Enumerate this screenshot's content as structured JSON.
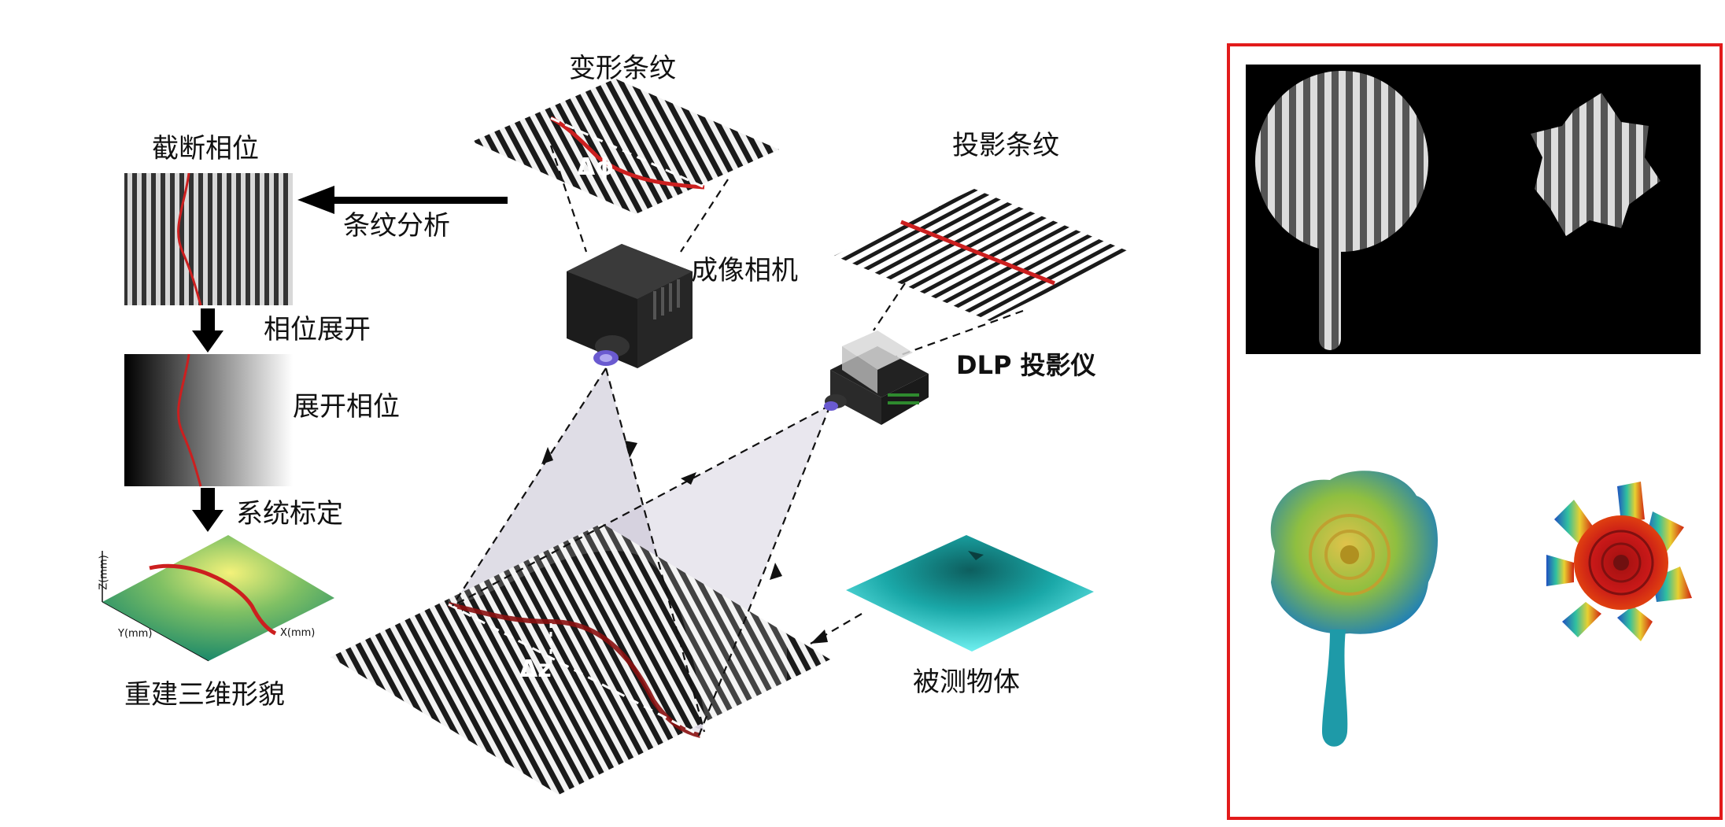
{
  "labels": {
    "deformed_fringe": "变形条纹",
    "projected_fringe": "投影条纹",
    "wrapped_phase": "截断相位",
    "fringe_analysis": "条纹分析",
    "camera": "成像相机",
    "phase_unwrapping": "相位展开",
    "dlp_projector": "DLP 投影仪",
    "unwrapped_phase": "展开相位",
    "system_calibration": "系统标定",
    "reconstruct_3d": "重建三维形貌",
    "measured_object": "被测物体",
    "delta_phi": "Δϕ",
    "delta_z": "Δz"
  },
  "axes": {
    "z": "Z(mm)",
    "y": "Y(mm)",
    "x": "X(mm)"
  },
  "colors": {
    "highlight_red": "#cc1f1f",
    "panel_border": "#e21b1b",
    "teal_object": "#1fc8c8",
    "surface_green": "#2e9a6a",
    "surface_yellow": "#f2ee6a"
  }
}
